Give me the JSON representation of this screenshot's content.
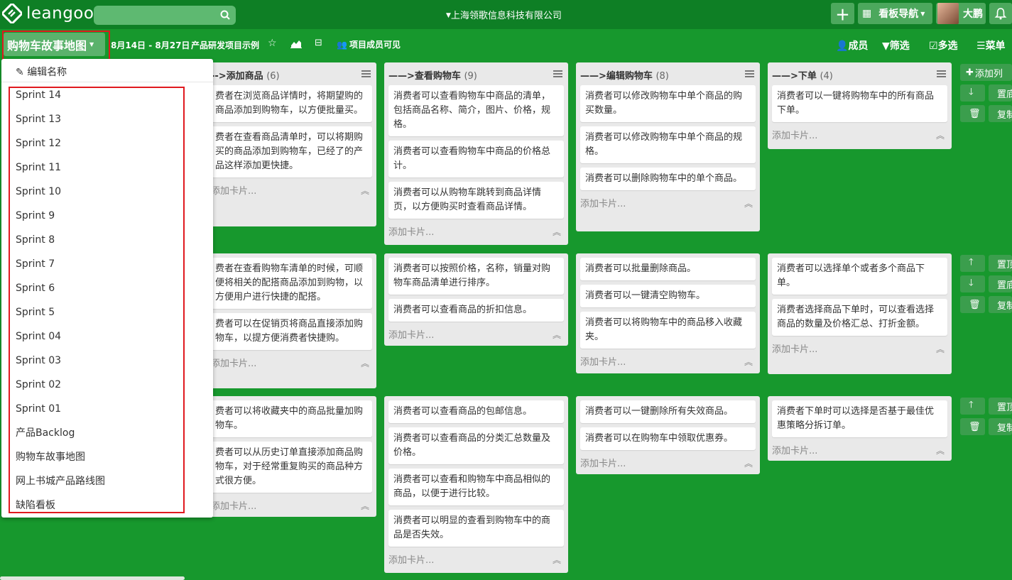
{
  "header": {
    "logo_text": "leangoo",
    "org_name": "上海领歌信息科技有限公司",
    "nav_label": "看板导航",
    "user_name": "大鹏",
    "search_placeholder": ""
  },
  "subbar": {
    "board_title": "购物车故事地图",
    "date_range": "8月14日 - 8月27日",
    "project_name": "产品研发项目示例",
    "visibility": "项目成员可见",
    "members": "成员",
    "filter": "筛选",
    "multi_select": "多选",
    "menu": "菜单"
  },
  "dropdown": {
    "edit_label": "编辑名称",
    "items": [
      "Sprint 14",
      "Sprint 13",
      "Sprint 12",
      "Sprint 11",
      "Sprint 10",
      "Sprint 9",
      "Sprint 8",
      "Sprint 7",
      "Sprint 6",
      "Sprint 5",
      "Sprint 04",
      "Sprint 03",
      "Sprint 02",
      "Sprint 01",
      "产品Backlog",
      "购物车故事地图",
      "网上书城产品路线图",
      "缺陷看板"
    ]
  },
  "add_card_label": "添加卡片...",
  "lanes": [
    {
      "columns": [
        {
          "title": "-->添加商品",
          "count": "(6)",
          "cards": [
            "费者在浏览商品详情时，将期望购的商品添加到购物车，以方便批量买。",
            "费者在查看商品清单时，可以将期购买的商品添加到购物车，已经了的产品这样添加更快捷。"
          ]
        },
        {
          "title": "——>查看购物车",
          "count": "(9)",
          "cards": [
            "消费者可以查看购物车中商品的清单，包括商品名称、简介，图片、价格，规格。",
            "消费者可以查看购物车中商品的价格总计。",
            "消费者可以从购物车跳转到商品详情页，以方便购买时查看商品详情。"
          ]
        },
        {
          "title": "——>编辑购物车",
          "count": "(8)",
          "cards": [
            "消费者可以修改购物车中单个商品的购买数量。",
            "消费者可以修改购物车中单个商品的规格。",
            "消费者可以删除购物车中的单个商品。"
          ]
        },
        {
          "title": "——>下单",
          "count": "(4)",
          "cards": [
            "消费者可以一键将购物车中的所有商品下单。"
          ]
        }
      ]
    },
    {
      "columns": [
        {
          "cards": [
            "费者在查看购物车清单的时候，可顺便将相关的配搭商品添加到购物，以方便用户进行快捷的配搭。",
            "费者可以在促销页将商品直接添加购物车，以提方便消费者快捷购。"
          ]
        },
        {
          "cards": [
            "消费者可以按照价格，名称，销量对购物车商品清单进行排序。",
            "消费者可以查看商品的折扣信息。"
          ]
        },
        {
          "cards": [
            "消费者可以批量删除商品。",
            "消费者可以一键清空购物车。",
            "消费者可以将购物车中的商品移入收藏夹。"
          ]
        },
        {
          "cards": [
            "消费者可以选择单个或者多个商品下单。",
            "消费者选择商品下单时，可以查看选择商品的数量及价格汇总、打折金额。"
          ]
        }
      ]
    },
    {
      "columns": [
        {
          "cards": [
            "费者可以将收藏夹中的商品批量加购物车。",
            "费者可以从历史订单直接添加商品购物车，对于经常重复购买的商品种方式很方便。"
          ]
        },
        {
          "cards": [
            "消费者可以查看商品的包邮信息。",
            "消费者可以查看商品的分类汇总数量及价格。",
            "消费者可以查看和购物车中商品相似的商品，以便于进行比较。",
            "消费者可以明显的查看到购物车中的商品是否失效。"
          ]
        },
        {
          "cards": [
            "消费者可以一键删除所有失效商品。",
            "消费者可以在购物车中领取优惠券。"
          ]
        },
        {
          "cards": [
            "消费者下单时可以选择是否基于最佳优惠策略分拆订单。"
          ]
        }
      ]
    }
  ],
  "side_actions": {
    "add_column": "添加列",
    "move_top": "置顶",
    "move_bottom": "置底",
    "copy": "复制"
  },
  "colors": {
    "topbar": "#0e7f25",
    "background": "#17982d",
    "highlight": "#e0191f"
  }
}
